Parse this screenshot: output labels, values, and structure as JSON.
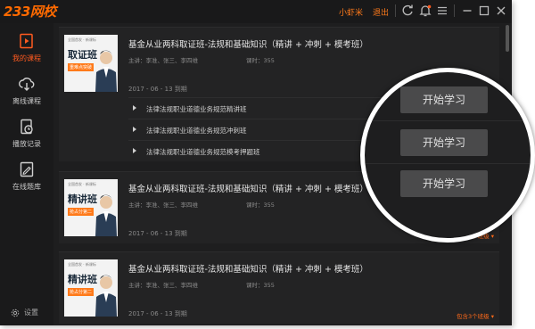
{
  "app": {
    "logo": "233网校"
  },
  "titlebar": {
    "username": "小虾米",
    "logout": "退出"
  },
  "sidebar": {
    "items": [
      {
        "label": "我的课程",
        "icon": "play-course-icon",
        "active": true
      },
      {
        "label": "离线课程",
        "icon": "cloud-download-icon",
        "active": false
      },
      {
        "label": "播放记录",
        "icon": "history-icon",
        "active": false
      },
      {
        "label": "在线题库",
        "icon": "edit-question-icon",
        "active": false
      }
    ],
    "settings": "设置"
  },
  "courses": [
    {
      "thumb": {
        "mini": "全国首发 · 新课标",
        "big": "取证班",
        "tag": "重难点突破"
      },
      "title": "基金从业两科取证班-法规和基础知识（精讲 + 冲刺 + 模考班）",
      "teachers": "主讲：李准、张三、李四维",
      "hours": "课时：355",
      "date": "2017 - 06 - 13 到期",
      "subs": [
        "法律法规职业道德业务规范精讲班",
        "法律法规职业道德业务规范冲刺班",
        "法律法规职业道德业务规范模考押题班"
      ]
    },
    {
      "thumb": {
        "mini": "全国首发 · 新课标",
        "big": "精讲班",
        "tag": "抢占分第二"
      },
      "title": "基金从业两科取证班-法规和基础知识（精讲 + 冲刺 + 模考班）",
      "teachers": "主讲：李准、张三、李四维",
      "hours": "课时：355",
      "date": "2017 - 06 - 13 到期",
      "expand": "包含3个班级 ▾"
    },
    {
      "thumb": {
        "mini": "全国首发 · 新课标",
        "big": "精讲班",
        "tag": "抢占分第二"
      },
      "title": "基金从业两科取证班-法规和基础知识（精讲 + 冲刺 + 模考班）",
      "teachers": "主讲：李准、张三、李四维",
      "hours": "课时：355",
      "date": "2017 - 06 - 13 到期",
      "expand": "包含3个班级 ▾"
    }
  ],
  "magnifier": {
    "buttons": [
      "开始学习",
      "开始学习",
      "开始学习"
    ]
  },
  "colors": {
    "accent": "#ff6a00",
    "background": "#1e1e1f",
    "button": "#4a4a4b"
  }
}
